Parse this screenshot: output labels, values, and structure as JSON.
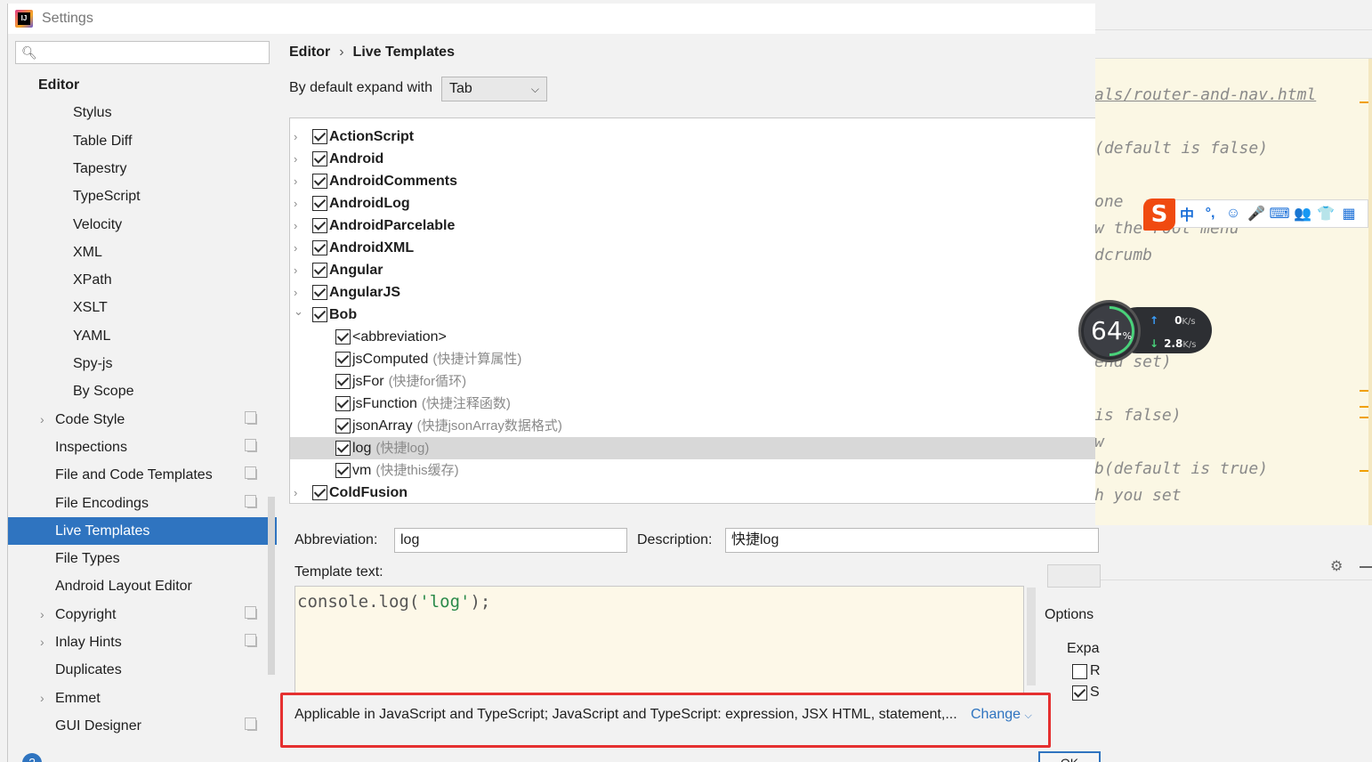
{
  "window": {
    "title": "Settings"
  },
  "search": {
    "placeholder": ""
  },
  "sidebar": {
    "items": [
      {
        "label": "Editor",
        "level": 0,
        "bold": true
      },
      {
        "label": "Stylus",
        "level": 2
      },
      {
        "label": "Table Diff",
        "level": 2
      },
      {
        "label": "Tapestry",
        "level": 2
      },
      {
        "label": "TypeScript",
        "level": 2
      },
      {
        "label": "Velocity",
        "level": 2
      },
      {
        "label": "XML",
        "level": 2
      },
      {
        "label": "XPath",
        "level": 2
      },
      {
        "label": "XSLT",
        "level": 2
      },
      {
        "label": "YAML",
        "level": 2
      },
      {
        "label": "Spy-js",
        "level": 2
      },
      {
        "label": "By Scope",
        "level": 2
      },
      {
        "label": "Code Style",
        "level": 1,
        "expandable": true,
        "copy": true
      },
      {
        "label": "Inspections",
        "level": 1,
        "copy": true
      },
      {
        "label": "File and Code Templates",
        "level": 1,
        "copy": true
      },
      {
        "label": "File Encodings",
        "level": 1,
        "copy": true
      },
      {
        "label": "Live Templates",
        "level": 1,
        "selected": true
      },
      {
        "label": "File Types",
        "level": 1
      },
      {
        "label": "Android Layout Editor",
        "level": 1
      },
      {
        "label": "Copyright",
        "level": 1,
        "expandable": true,
        "copy": true
      },
      {
        "label": "Inlay Hints",
        "level": 1,
        "expandable": true,
        "copy": true
      },
      {
        "label": "Duplicates",
        "level": 1
      },
      {
        "label": "Emmet",
        "level": 1,
        "expandable": true
      },
      {
        "label": "GUI Designer",
        "level": 1,
        "copy": true
      }
    ]
  },
  "breadcrumb": {
    "parent": "Editor",
    "separator": "›",
    "current": "Live Templates"
  },
  "expand": {
    "label": "By default expand with",
    "value": "Tab"
  },
  "templates": [
    {
      "type": "group",
      "label": "ActionScript",
      "expanded": false
    },
    {
      "type": "group",
      "label": "Android",
      "expanded": false
    },
    {
      "type": "group",
      "label": "AndroidComments",
      "expanded": false
    },
    {
      "type": "group",
      "label": "AndroidLog",
      "expanded": false
    },
    {
      "type": "group",
      "label": "AndroidParcelable",
      "expanded": false
    },
    {
      "type": "group",
      "label": "AndroidXML",
      "expanded": false
    },
    {
      "type": "group",
      "label": "Angular",
      "expanded": false
    },
    {
      "type": "group",
      "label": "AngularJS",
      "expanded": false
    },
    {
      "type": "group",
      "label": "Bob",
      "expanded": true
    },
    {
      "type": "item",
      "label": "<abbreviation>",
      "desc": ""
    },
    {
      "type": "item",
      "label": "jsComputed",
      "desc": "(快捷计算属性)"
    },
    {
      "type": "item",
      "label": "jsFor",
      "desc": "(快捷for循环)"
    },
    {
      "type": "item",
      "label": "jsFunction",
      "desc": "(快捷注释函数)"
    },
    {
      "type": "item",
      "label": "jsonArray",
      "desc": "(快捷jsonArray数据格式)"
    },
    {
      "type": "item",
      "label": "log",
      "desc": "(快捷log)",
      "selected": true
    },
    {
      "type": "item",
      "label": "vm",
      "desc": "(快捷this缓存)"
    },
    {
      "type": "group",
      "label": "ColdFusion",
      "expanded": false
    }
  ],
  "editor": {
    "abbreviation_label": "Abbreviation:",
    "abbreviation_value": "log",
    "description_label": "Description:",
    "description_value": "快捷log",
    "template_text_label": "Template text:",
    "template_code_prefix": "console.log(",
    "template_code_string": "'log'",
    "template_code_suffix": ");",
    "applicable": "Applicable in JavaScript and TypeScript; JavaScript and TypeScript: expression, JSX HTML, statement,...",
    "change_link": "Change",
    "options_label": "Options",
    "expand_label": "Expa",
    "opt1_text": "R",
    "opt2_text": "S",
    "ok_label": "OK"
  },
  "background_code": [
    "als/router-and-nav.html",
    "(default is false)",
    " one",
    "w the root menu",
    "dcrumb",
    "end set)",
    " is false)",
    "w",
    "b(default is true)",
    "h you set"
  ],
  "ime": {
    "chars": [
      "中",
      "°,",
      "☺",
      "🎤",
      "⌨",
      "👥",
      "👕",
      "▦"
    ]
  },
  "network": {
    "percent": "64",
    "percent_unit": "%",
    "up": "0",
    "down": "2.8",
    "unit": "K/s"
  },
  "colors": {
    "selection": "#2f74c0",
    "highlight": "#e53030",
    "template_bg": "#fdf8e8"
  }
}
